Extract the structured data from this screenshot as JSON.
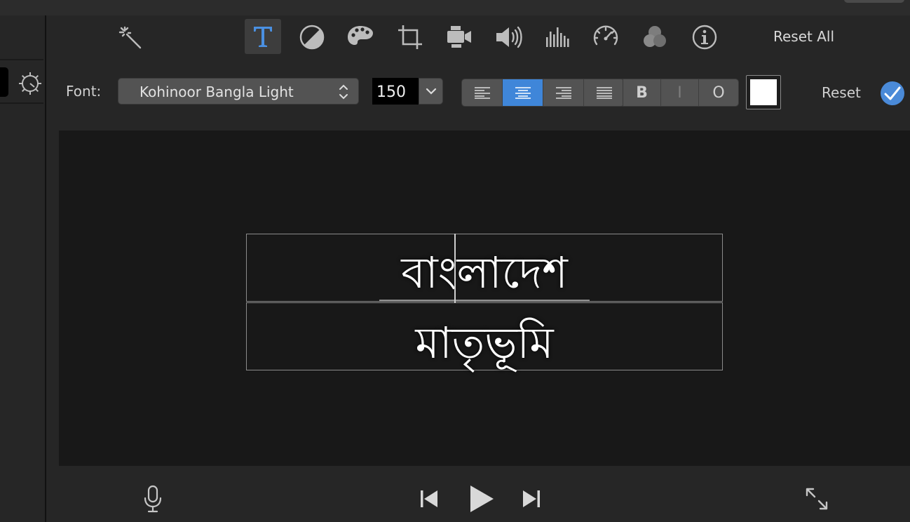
{
  "toolbar": {
    "tools": [
      {
        "name": "enhance",
        "icon": "magic-wand-icon"
      },
      {
        "name": "titles",
        "icon": "text-t-icon",
        "active": true
      },
      {
        "name": "color-balance",
        "icon": "color-balance-icon"
      },
      {
        "name": "color-correction",
        "icon": "palette-icon"
      },
      {
        "name": "crop",
        "icon": "crop-icon"
      },
      {
        "name": "stabilization",
        "icon": "video-camera-icon"
      },
      {
        "name": "volume",
        "icon": "speaker-icon"
      },
      {
        "name": "noise-reduction",
        "icon": "equalizer-icon"
      },
      {
        "name": "speed",
        "icon": "speedometer-icon"
      },
      {
        "name": "clip-filter",
        "icon": "filter-circles-icon"
      },
      {
        "name": "info",
        "icon": "info-icon"
      }
    ],
    "reset_all_label": "Reset All"
  },
  "title_settings": {
    "font_label": "Font:",
    "font_value": "Kohinoor Bangla Light",
    "size_value": "150",
    "alignment": [
      "left",
      "center",
      "right",
      "justify"
    ],
    "alignment_selected": "center",
    "style_bold": "B",
    "style_italic": "I",
    "style_outline": "O",
    "text_color": "#ffffff",
    "reset_label": "Reset",
    "accent_color": "#3f86d9"
  },
  "viewer": {
    "title_line1": "বাংলাদেশ",
    "title_line2": "মাতৃভূমি"
  },
  "playback": {
    "controls": [
      "microphone-icon",
      "skip-back-icon",
      "play-icon",
      "skip-forward-icon",
      "fullscreen-icon"
    ]
  }
}
